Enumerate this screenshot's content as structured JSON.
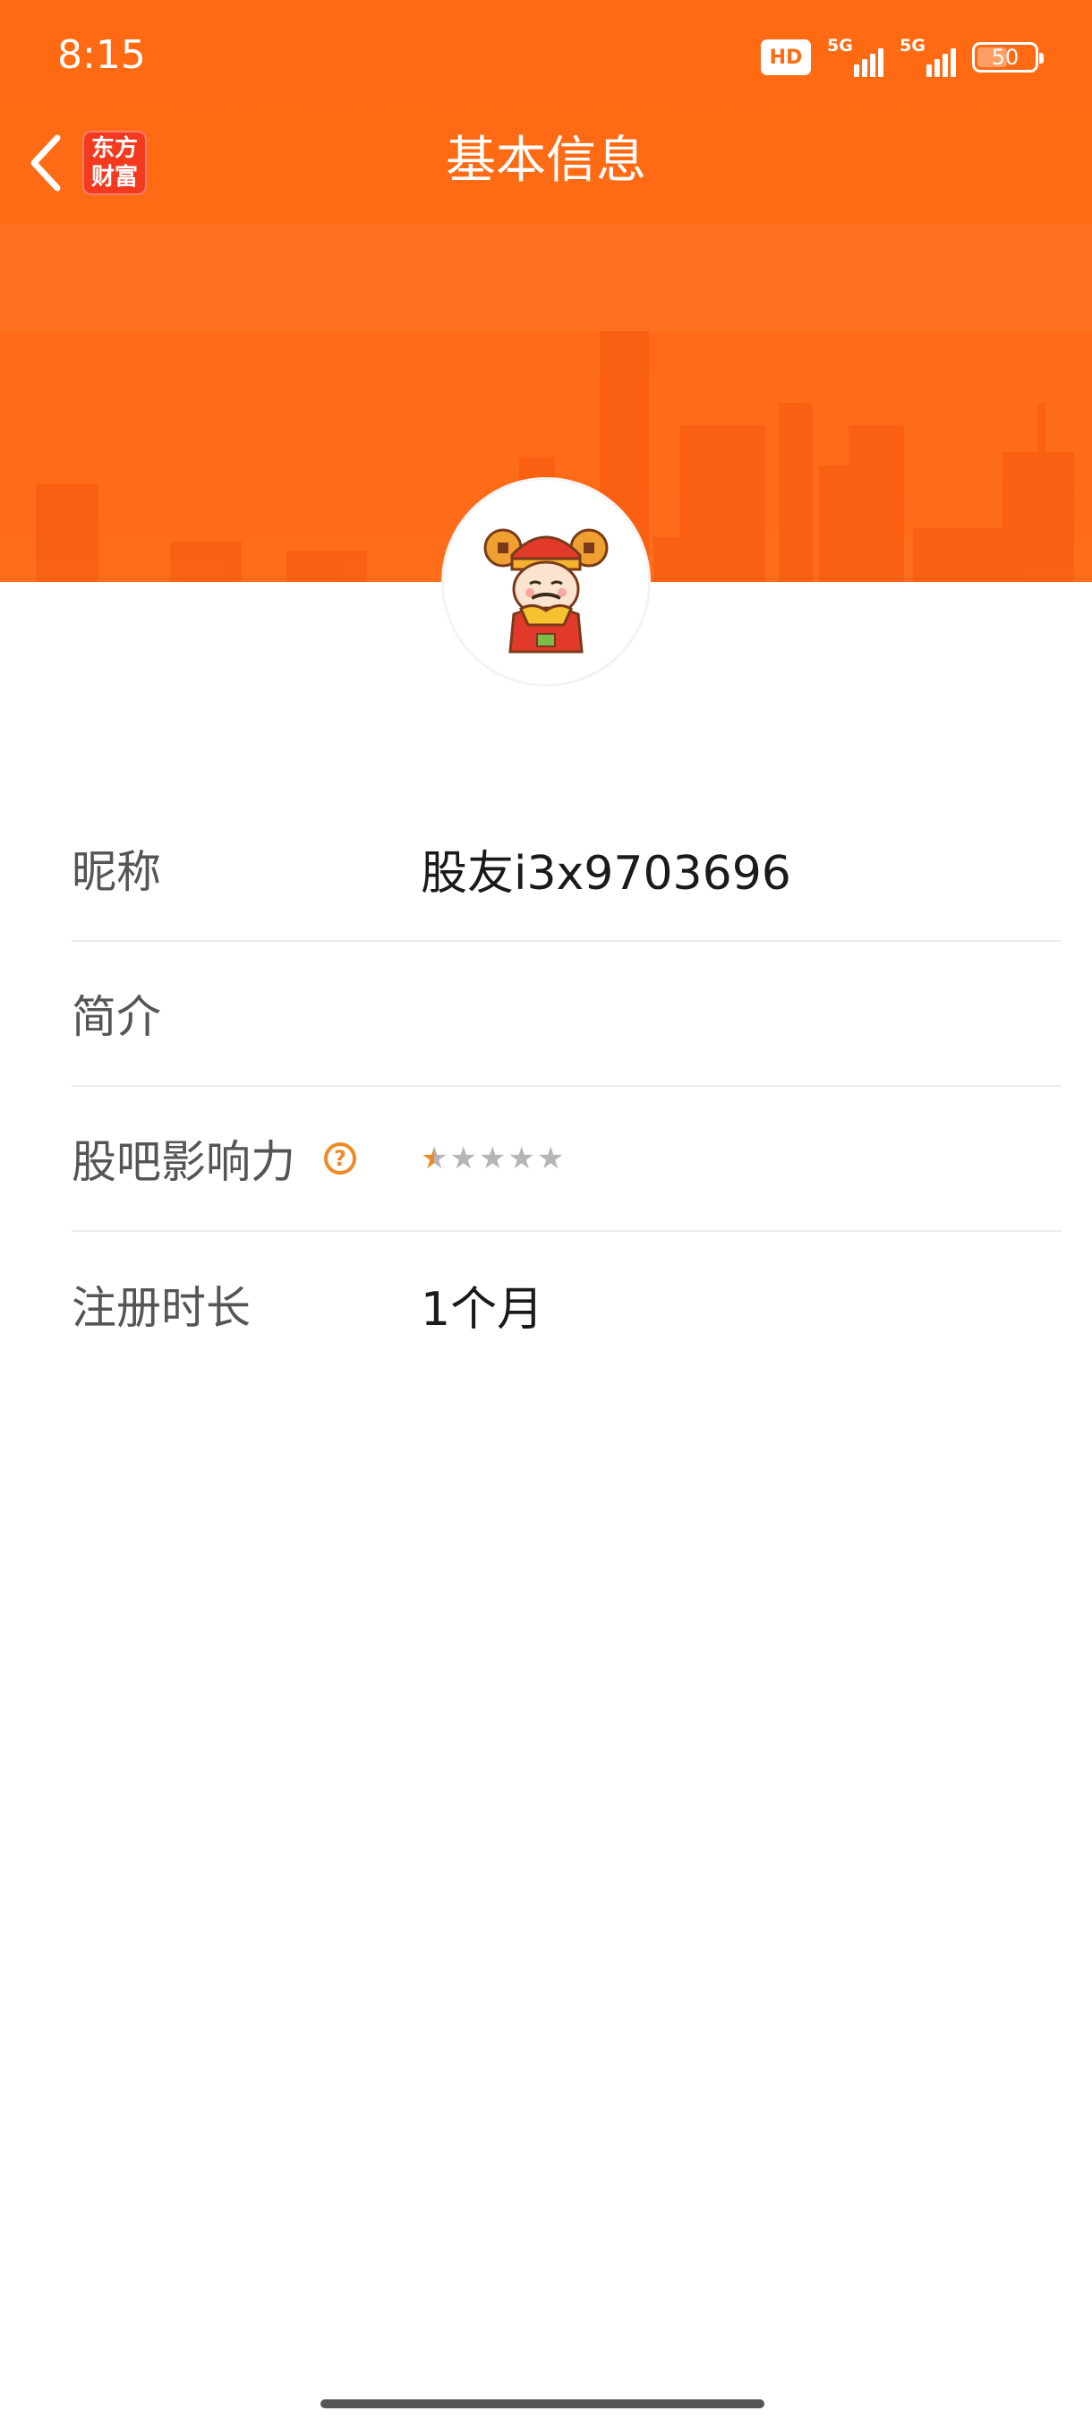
{
  "status_bar": {
    "time": "8:15",
    "hd_label": "HD",
    "network_1": "5G",
    "network_2": "5G",
    "battery_level": "50"
  },
  "header": {
    "title": "基本信息",
    "logo_text_line1": "东方",
    "logo_text_line2": "财富"
  },
  "profile": {
    "nickname_label": "昵称",
    "nickname_value": "股友i3x9703696",
    "intro_label": "简介",
    "intro_value": "",
    "influence_label": "股吧影响力",
    "influence_help": "?",
    "influence_stars": {
      "rating": 0.5,
      "max": 5
    },
    "register_label": "注册时长",
    "register_value": "1个月"
  },
  "colors": {
    "header_orange": "#ff6a12",
    "logo_red": "#f33a1e",
    "accent_orange": "#f08a25"
  },
  "icons": {
    "back": "chevron-left-icon",
    "help": "question-circle-icon",
    "star": "star-icon"
  }
}
